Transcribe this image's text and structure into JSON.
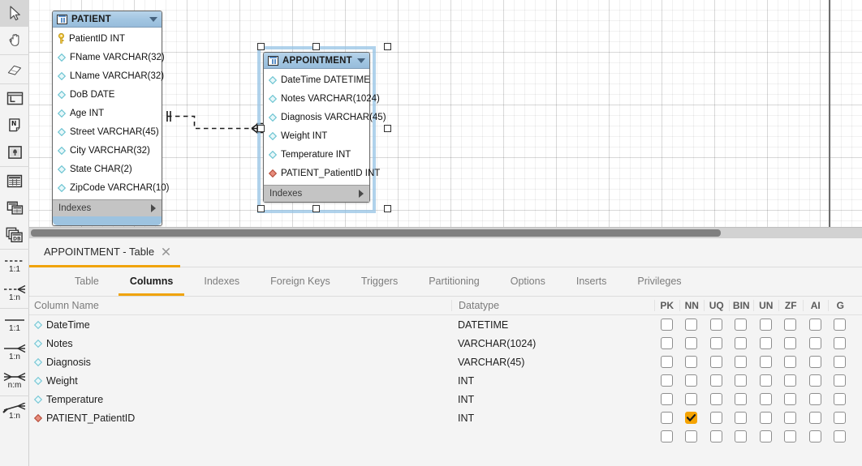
{
  "toolbar": {
    "items": [
      {
        "name": "pointer-tool",
        "icon": "pointer-icon",
        "selected": true
      },
      {
        "name": "hand-tool",
        "icon": "hand-icon",
        "selected": false
      },
      {
        "name": "eraser-tool",
        "icon": "eraser-icon",
        "selected": false
      },
      {
        "name": "layer-tool",
        "icon": "layer-icon",
        "selected": false
      },
      {
        "name": "note-tool",
        "icon": "note-icon",
        "selected": false
      },
      {
        "name": "image-tool",
        "icon": "image-icon",
        "selected": false
      },
      {
        "name": "table-tool",
        "icon": "table-icon",
        "selected": false
      },
      {
        "name": "view-tool",
        "icon": "view-icon",
        "selected": false
      },
      {
        "name": "routine-group-tool",
        "icon": "routine-group-icon",
        "selected": false
      }
    ],
    "relationship_tools": [
      {
        "name": "relationship-1-1-identifying",
        "label": "1:1",
        "style": "dashed",
        "crow": false
      },
      {
        "name": "relationship-1-n-identifying",
        "label": "1:n",
        "style": "dashed",
        "crow": true
      },
      {
        "name": "relationship-1-1-non-identifying",
        "label": "1:1",
        "style": "solid",
        "crow": false
      },
      {
        "name": "relationship-1-n-non-identifying",
        "label": "1:n",
        "style": "solid",
        "crow": true
      },
      {
        "name": "relationship-n-m",
        "label": "n:m",
        "style": "solid",
        "crow": true
      },
      {
        "name": "relationship-pick-columns",
        "label": "1:n",
        "style": "solid",
        "crow": true
      }
    ]
  },
  "diagram": {
    "tables": [
      {
        "name": "PATIENT",
        "selected": false,
        "indexes_label": "Indexes",
        "columns": [
          {
            "label": "PatientID INT",
            "glyph": "primary-key-icon"
          },
          {
            "label": "FName VARCHAR(32)",
            "glyph": "column-icon"
          },
          {
            "label": "LName VARCHAR(32)",
            "glyph": "column-icon"
          },
          {
            "label": "DoB DATE",
            "glyph": "column-icon"
          },
          {
            "label": "Age INT",
            "glyph": "column-icon"
          },
          {
            "label": "Street VARCHAR(45)",
            "glyph": "column-icon"
          },
          {
            "label": "City VARCHAR(32)",
            "glyph": "column-icon"
          },
          {
            "label": "State CHAR(2)",
            "glyph": "column-icon"
          },
          {
            "label": "ZipCode VARCHAR(10)",
            "glyph": "column-icon"
          }
        ]
      },
      {
        "name": "APPOINTMENT",
        "selected": true,
        "indexes_label": "Indexes",
        "columns": [
          {
            "label": "DateTime DATETIME",
            "glyph": "column-icon"
          },
          {
            "label": "Notes VARCHAR(1024)",
            "glyph": "column-icon"
          },
          {
            "label": "Diagnosis VARCHAR(45)",
            "glyph": "column-icon"
          },
          {
            "label": "Weight INT",
            "glyph": "column-icon"
          },
          {
            "label": "Temperature INT",
            "glyph": "column-icon"
          },
          {
            "label": "PATIENT_PatientID INT",
            "glyph": "foreign-key-icon"
          }
        ]
      }
    ],
    "relationship": {
      "name": "relationship-patient-appointment",
      "style": "dashed",
      "from": "PATIENT",
      "to": "APPOINTMENT",
      "cardinality": "1:n"
    }
  },
  "editor": {
    "document_tab": {
      "label": "APPOINTMENT - Table",
      "close_icon": "close-icon"
    },
    "tabs": [
      {
        "label": "Table",
        "active": false
      },
      {
        "label": "Columns",
        "active": true
      },
      {
        "label": "Indexes",
        "active": false
      },
      {
        "label": "Foreign Keys",
        "active": false
      },
      {
        "label": "Triggers",
        "active": false
      },
      {
        "label": "Partitioning",
        "active": false
      },
      {
        "label": "Options",
        "active": false
      },
      {
        "label": "Inserts",
        "active": false
      },
      {
        "label": "Privileges",
        "active": false
      }
    ],
    "grid": {
      "headers": {
        "column_name": "Column Name",
        "datatype": "Datatype",
        "flags": [
          "PK",
          "NN",
          "UQ",
          "BIN",
          "UN",
          "ZF",
          "AI",
          "G"
        ]
      },
      "rows": [
        {
          "glyph": "column-icon",
          "name": "DateTime",
          "datatype": "DATETIME",
          "flags": [
            false,
            false,
            false,
            false,
            false,
            false,
            false,
            false
          ]
        },
        {
          "glyph": "column-icon",
          "name": "Notes",
          "datatype": "VARCHAR(1024)",
          "flags": [
            false,
            false,
            false,
            false,
            false,
            false,
            false,
            false
          ]
        },
        {
          "glyph": "column-icon",
          "name": "Diagnosis",
          "datatype": "VARCHAR(45)",
          "flags": [
            false,
            false,
            false,
            false,
            false,
            false,
            false,
            false
          ]
        },
        {
          "glyph": "column-icon",
          "name": "Weight",
          "datatype": "INT",
          "flags": [
            false,
            false,
            false,
            false,
            false,
            false,
            false,
            false
          ]
        },
        {
          "glyph": "column-icon",
          "name": "Temperature",
          "datatype": "INT",
          "flags": [
            false,
            false,
            false,
            false,
            false,
            false,
            false,
            false
          ]
        },
        {
          "glyph": "foreign-key-icon",
          "name": "PATIENT_PatientID",
          "datatype": "INT",
          "flags": [
            false,
            true,
            false,
            false,
            false,
            false,
            false,
            false
          ]
        },
        {
          "glyph": "none",
          "name": "",
          "datatype": "",
          "flags": [
            false,
            false,
            false,
            false,
            false,
            false,
            false,
            false
          ]
        }
      ]
    }
  },
  "colors": {
    "accent": "#f0a30a",
    "checkbox_on": "#f5a300",
    "table_header": "#a3c6e2",
    "table_footer": "#c4c4c4",
    "selection": "#96c3e4",
    "fk_glyph": "#e08070",
    "column_glyph": "#8fd0da",
    "pk_glyph": "#f2c53d"
  }
}
